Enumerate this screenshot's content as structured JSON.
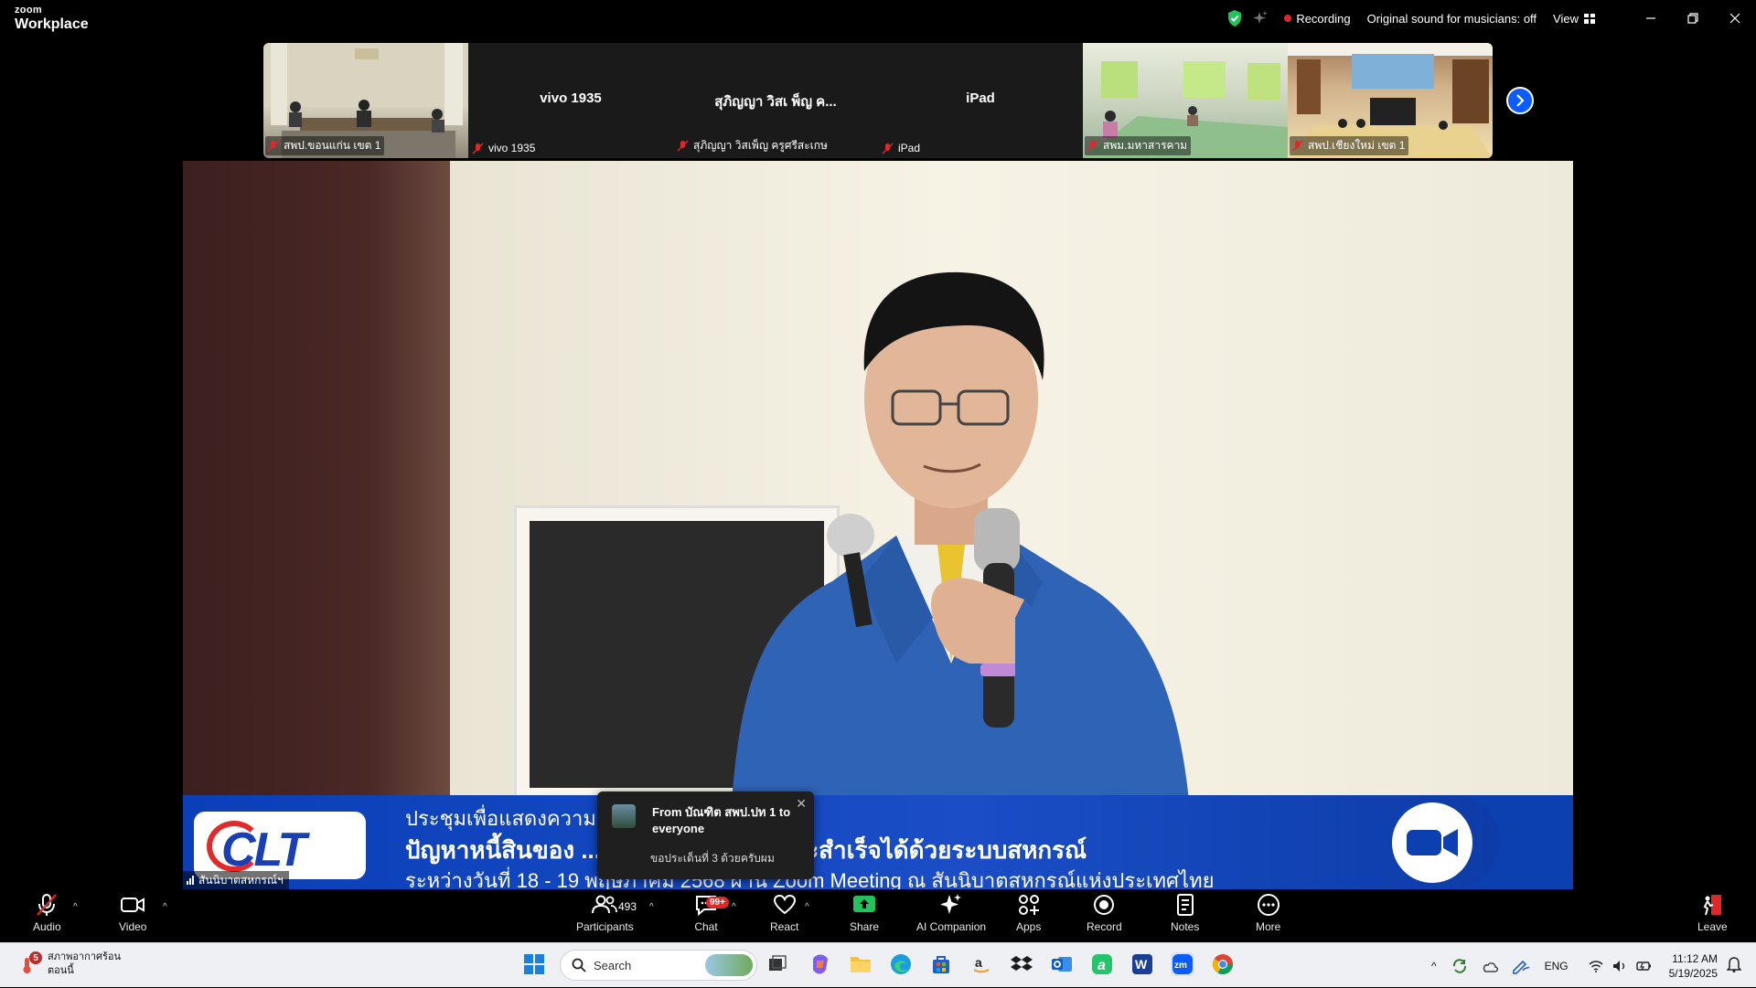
{
  "titlebar": {
    "brand_top": "zoom",
    "brand_bottom": "Workplace",
    "recording_label": "Recording",
    "sound_label": "Original sound for musicians: off",
    "view_label": "View"
  },
  "thumbnails": [
    {
      "name": "สพป.ขอนแก่น เขต 1",
      "center_name": "",
      "video": true
    },
    {
      "name": "vivo 1935",
      "center_name": "vivo 1935",
      "video": false
    },
    {
      "name": "สุภิญญา วิสเพ็ญ ครูศรีสะเกษ",
      "center_name": "สุภิญญา วิสเ พ็ญ ค...",
      "video": false
    },
    {
      "name": "iPad",
      "center_name": "iPad",
      "video": false
    },
    {
      "name": "สพม.มหาสารคาม",
      "center_name": "",
      "video": true
    },
    {
      "name": "สพป.เชียงใหม่ เขต 1",
      "center_name": "",
      "video": true
    }
  ],
  "main_video": {
    "speaker_label": "สันนิบาตสหกรณ์ฯ",
    "banner": {
      "logo_text": "CLT",
      "line1": "ประชุมเพื่อแสดงความ",
      "line2": "ปัญหาหนี้สินของ           ...ฐบาลอยากแก้ไข : จะสำเร็จได้ด้วยระบบสหกรณ์",
      "line3": "ระหว่างวันที่  18 - 19 พฤษภาคม 2568 ผ่าน Zoom Meeting ณ สันนิบาตสหกรณ์แห่งประเทศไทย"
    }
  },
  "chat_toast": {
    "from": "From บัณฑิต สพป.ปท 1 to everyone",
    "message": "ขอประเด็นที่ 3 ด้วยครับผม",
    "close": "✕"
  },
  "toolbar": {
    "audio": "Audio",
    "video": "Video",
    "participants": "Participants",
    "participants_count": "493",
    "chat": "Chat",
    "chat_badge": "99+",
    "react": "React",
    "share": "Share",
    "ai_companion": "AI Companion",
    "apps": "Apps",
    "record": "Record",
    "notes": "Notes",
    "more": "More",
    "leave": "Leave"
  },
  "taskbar": {
    "weather_badge": "5",
    "weather_line1": "สภาพอากาศร้อน",
    "weather_line2": "ตอนนี้",
    "search_placeholder": "Search",
    "lang": "ENG",
    "time": "11:12 AM",
    "date": "5/19/2025"
  },
  "colors": {
    "accent": "#0b5cff",
    "record_red": "#e02828",
    "share_green": "#21c35a",
    "banner_blue": "#0c3fb0"
  }
}
